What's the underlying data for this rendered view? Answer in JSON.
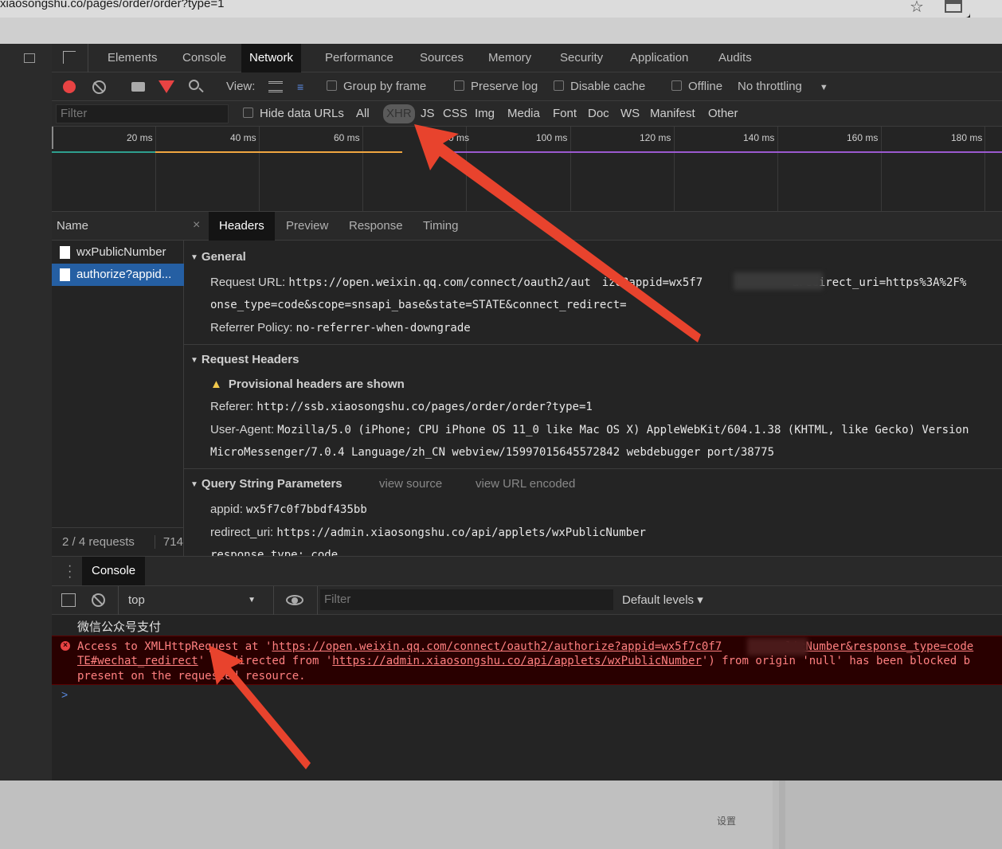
{
  "browser": {
    "address": "xiaosongshu.co/pages/order/order?type=1"
  },
  "devtools": {
    "tabs": [
      "Elements",
      "Console",
      "Network",
      "Performance",
      "Sources",
      "Memory",
      "Security",
      "Application",
      "Audits"
    ],
    "active_tab": "Network",
    "toolbar": {
      "view_label": "View:",
      "group_by_frame": "Group by frame",
      "preserve_log": "Preserve log",
      "disable_cache": "Disable cache",
      "offline": "Offline",
      "throttling": "No throttling"
    },
    "filterbar": {
      "placeholder": "Filter",
      "hide_data_urls": "Hide data URLs",
      "types": [
        "All",
        "XHR",
        "JS",
        "CSS",
        "Img",
        "Media",
        "Font",
        "Doc",
        "WS",
        "Manifest",
        "Other"
      ],
      "active_type": "XHR"
    },
    "timeline_ticks": [
      "20 ms",
      "40 ms",
      "60 ms",
      "0 ms",
      "100 ms",
      "120 ms",
      "140 ms",
      "160 ms",
      "180 ms"
    ],
    "requests": {
      "header": "Name",
      "items": [
        "wxPublicNumber",
        "authorize?appid..."
      ],
      "selected": "authorize?appid...",
      "status": "2 / 4 requests",
      "size": "714"
    },
    "detail": {
      "close": "×",
      "tabs": [
        "Headers",
        "Preview",
        "Response",
        "Timing"
      ],
      "active": "Headers",
      "general": {
        "title": "General",
        "request_url_label": "Request URL:",
        "request_url_a": "https://open.weixin.qq.com/connect/oauth2/aut",
        "request_url_b": "ize?appid=wx5f7",
        "request_url_c": "&redirect_uri=https%3A%2F%",
        "request_url_line2": "onse_type=code&scope=snsapi_base&state=STATE&connect_redirect=",
        "referrer_policy_label": "Referrer Policy:",
        "referrer_policy": "no-referrer-when-downgrade"
      },
      "request_headers": {
        "title": "Request Headers",
        "warning": "Provisional headers are shown",
        "referer_label": "Referer:",
        "referer": "http://ssb.xiaosongshu.co/pages/order/order?type=1",
        "user_agent_label": "User-Agent:",
        "user_agent": "Mozilla/5.0 (iPhone; CPU iPhone OS 11_0 like Mac OS X) AppleWebKit/604.1.38 (KHTML, like Gecko) Version",
        "user_agent_line2": "MicroMessenger/7.0.4 Language/zh_CN webview/15997015645572842 webdebugger port/38775"
      },
      "query": {
        "title": "Query String Parameters",
        "view_source": "view source",
        "view_url_encoded": "view URL encoded",
        "appid_label": "appid:",
        "appid": "wx5f7c0f7bbdf435bb",
        "redirect_label": "redirect_uri:",
        "redirect": "https://admin.xiaosongshu.co/api/applets/wxPublicNumber",
        "cut": "response_type: code"
      }
    },
    "drawer": {
      "tab": "Console"
    },
    "console_toolbar": {
      "context": "top",
      "filter_placeholder": "Filter",
      "levels": "Default levels ▾"
    },
    "console": {
      "log_line": "微信公众号支付",
      "error_l1_a": "Access to XMLHttpRequest at '",
      "error_l1_link": "https://open.weixin.qq.com/connect/oauth2/authorize?appid=wx5f7c0f7",
      "error_l1_link_b": "licNumber&response_type=code",
      "error_l2_link": "TE#wechat_redirect",
      "error_l2_mid": "' (redirected from '",
      "error_l2_link2": "https://admin.xiaosongshu.co/api/applets/wxPublicNumber",
      "error_l2_tail": "') from origin 'null' has been blocked b",
      "error_l3": "present on the requested resource.",
      "prompt": ">"
    }
  },
  "page_bottom": {
    "settings_label": "设置"
  },
  "colors": {
    "arrow": "#e8432d",
    "selected_row": "#255fa3"
  }
}
